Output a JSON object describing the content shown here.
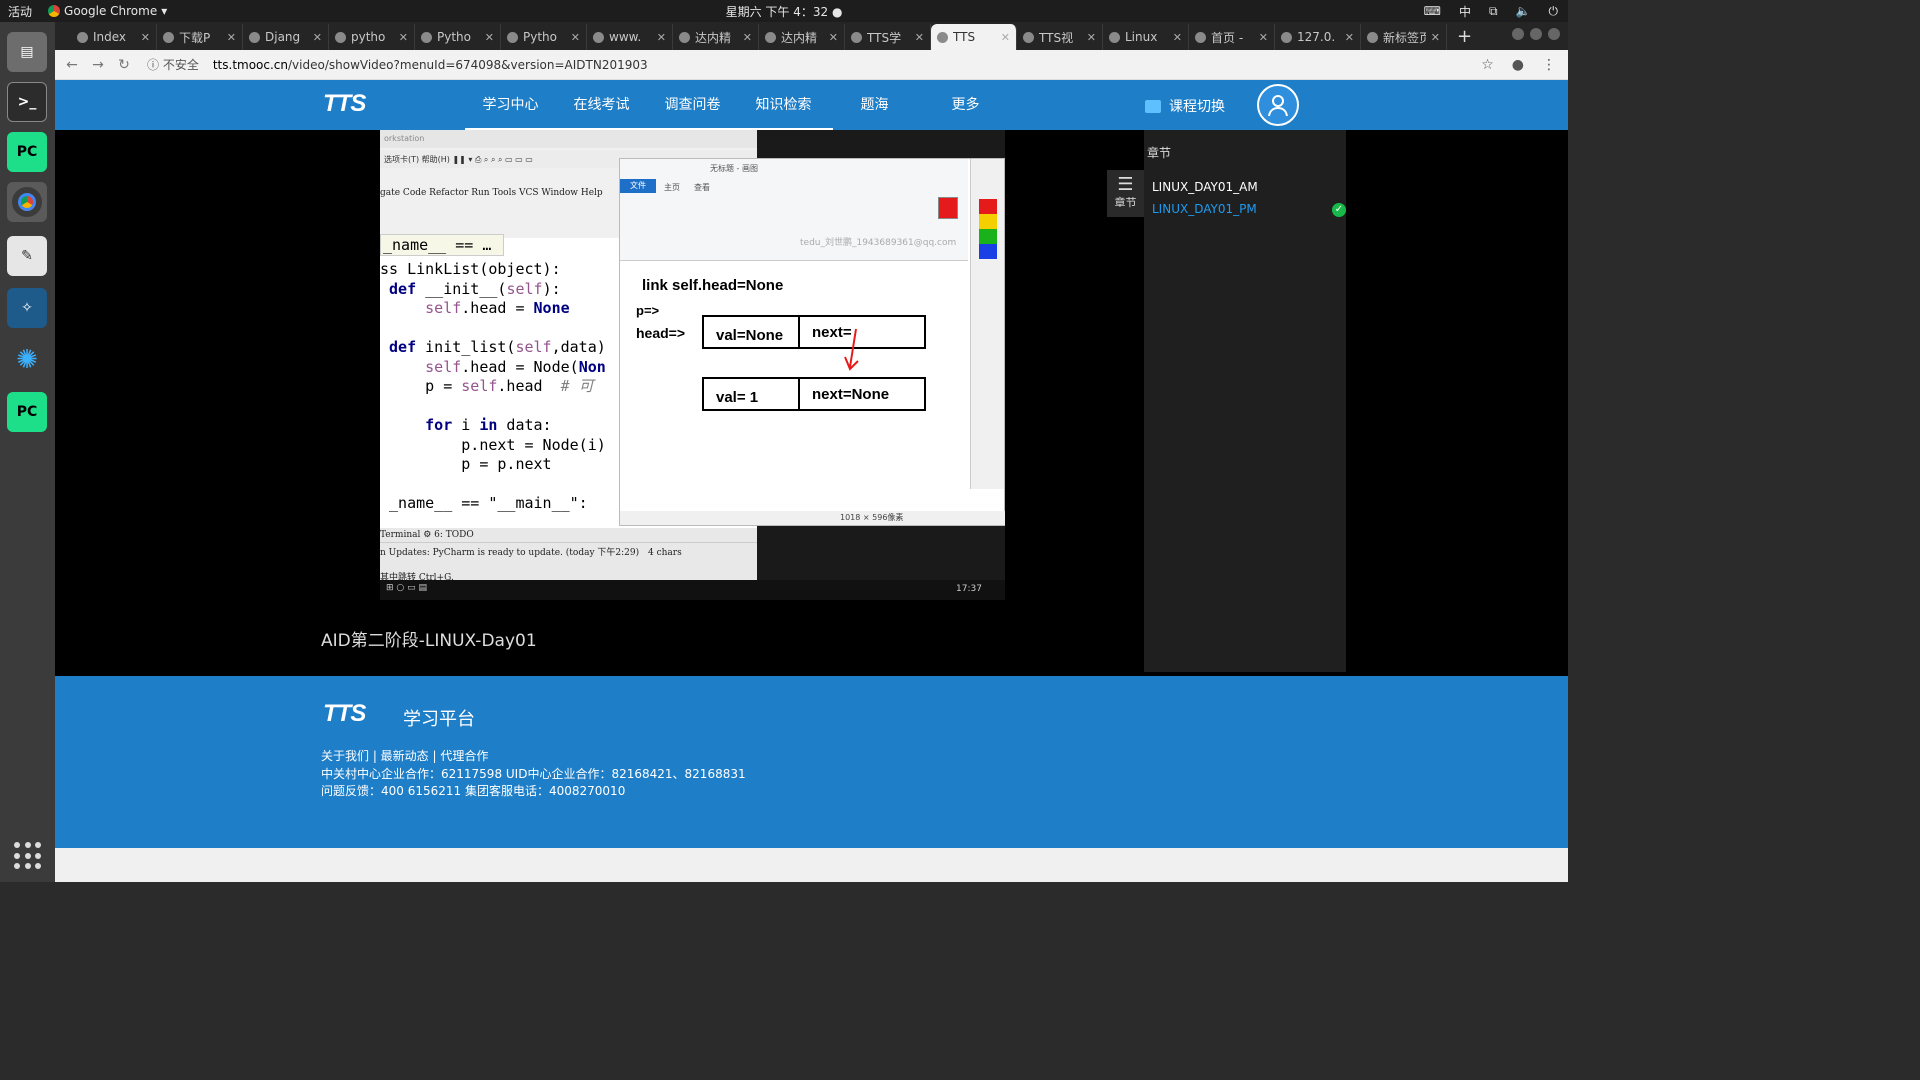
{
  "system": {
    "activities": "活动",
    "app_name": "Google Chrome",
    "clock": "星期六 下午 4：32",
    "input_method": "中"
  },
  "tabs": [
    {
      "title": "Index"
    },
    {
      "title": "下载P"
    },
    {
      "title": "Djang"
    },
    {
      "title": "pytho"
    },
    {
      "title": "Pytho"
    },
    {
      "title": "Pytho"
    },
    {
      "title": "www."
    },
    {
      "title": "达内精"
    },
    {
      "title": "达内精"
    },
    {
      "title": "TTS学"
    },
    {
      "title": "TTS",
      "active": true
    },
    {
      "title": "TTS视"
    },
    {
      "title": "Linux"
    },
    {
      "title": "首页 -"
    },
    {
      "title": "127.0."
    },
    {
      "title": "新标签页"
    }
  ],
  "address": {
    "security": "不安全",
    "host": "tts.tmooc.cn",
    "path": "/video/showVideo?menuId=674098&version=AIDTN201903"
  },
  "site": {
    "logo": "TTS",
    "nav": [
      "学习中心",
      "在线考试",
      "调查问卷",
      "知识检索",
      "题海",
      "更多"
    ],
    "course_switch": "课程切换"
  },
  "video": {
    "title": "AID第二阶段-LINUX-Day01",
    "ide": {
      "window_title": "orkstation",
      "menu": "gate  Code  Refactor  Run  Tools  VCS  Window  Help",
      "name_bar": "_name__ == …",
      "status_line": "n Updates: PyCharm is ready to update. (today 下午2:29)",
      "chars": "4 chars",
      "hint": "其中跳转 Ctrl+G."
    },
    "paint": {
      "title": "无标题 - 画图",
      "file_tab": "文件",
      "home_tab": "主页",
      "view_tab": "查看",
      "watermark": "tedu_刘世鹏_1943689361@qq.com",
      "size": "1018 × 596像素",
      "diagram": {
        "line1": "link   self.head=None",
        "p_label": "p=>",
        "head_label": "head=>",
        "node1_val": "val=None",
        "node1_next": "next=",
        "node2_val": "val= 1",
        "node2_next": "next=None"
      }
    },
    "win_clock": "17:37"
  },
  "chapters": {
    "heading": "章节",
    "toggle_label": "章节",
    "items": [
      {
        "label": "LINUX_DAY01_AM",
        "color": "#ffffff"
      },
      {
        "label": "LINUX_DAY01_PM",
        "color": "#1e9bf0",
        "done": true
      }
    ]
  },
  "footer": {
    "platform": "学习平台",
    "links": "关于我们 |  最新动态 |  代理合作",
    "line1": "中关村中心企业合作：62117598     UID中心企业合作：82168421、82168831",
    "line2": "问题反馈：400 6156211     集团客服电话：4008270010"
  }
}
